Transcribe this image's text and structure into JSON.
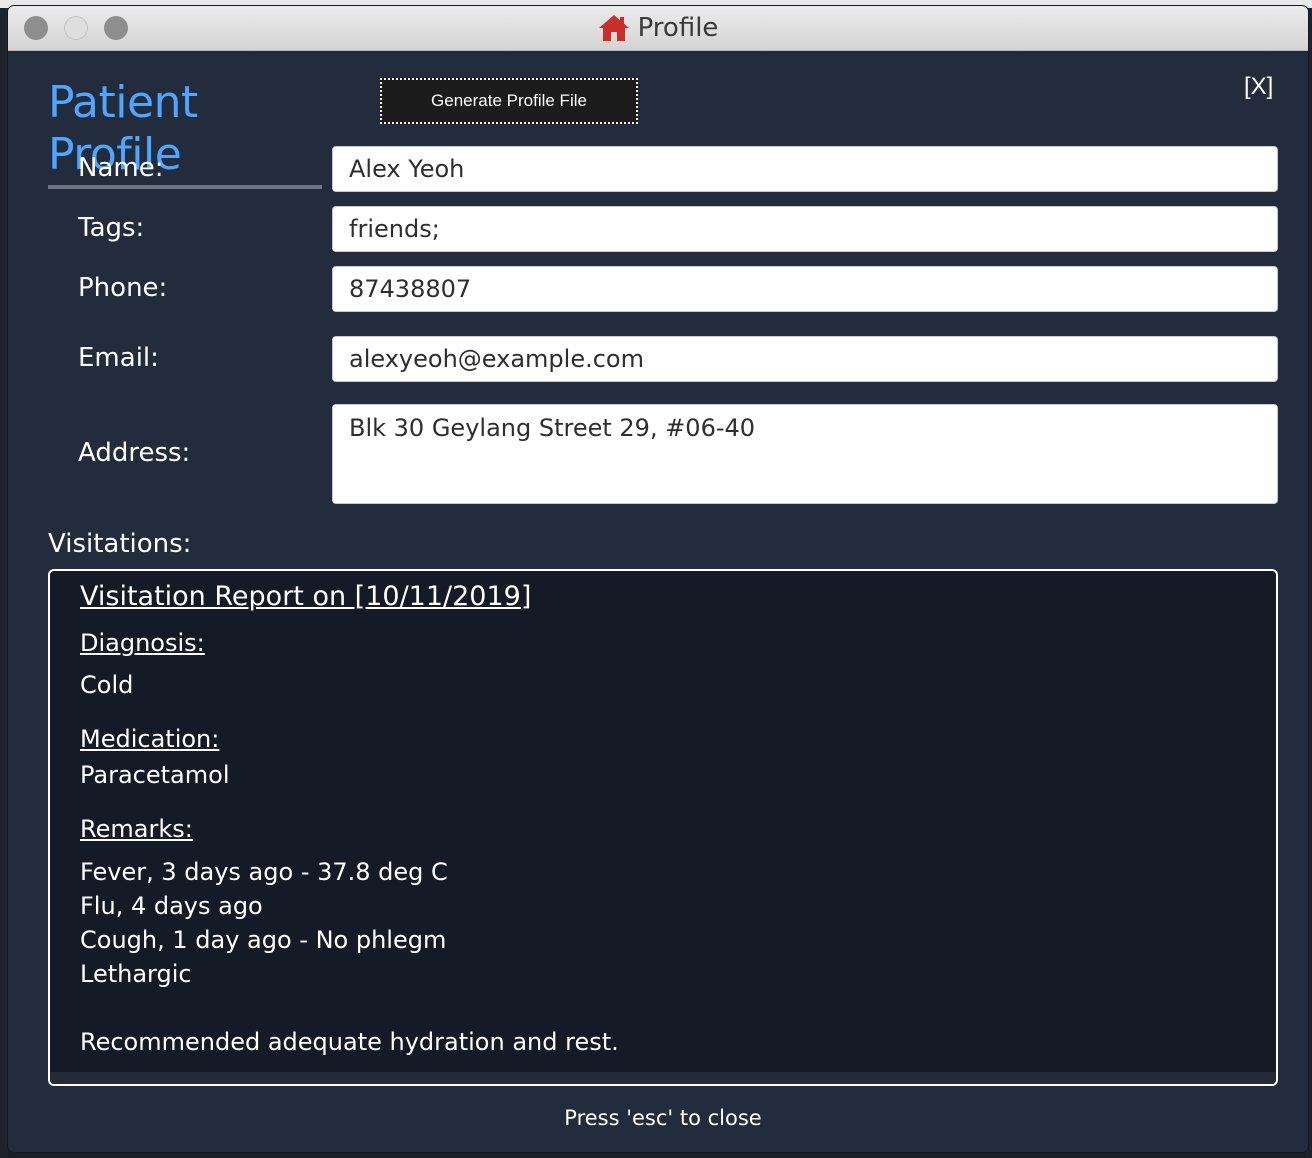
{
  "window": {
    "title": "Profile",
    "title_icon": "home-icon"
  },
  "header": {
    "page_title": "Patient Profile",
    "generate_button": "Generate Profile File",
    "close_label": "[X]"
  },
  "fields": {
    "name": {
      "label": "Name:",
      "value": "Alex Yeoh"
    },
    "tags": {
      "label": "Tags:",
      "value": "friends;"
    },
    "phone": {
      "label": "Phone:",
      "value": "87438807"
    },
    "email": {
      "label": "Email:",
      "value": "alexyeoh@example.com"
    },
    "address": {
      "label": "Address:",
      "value": "Blk 30 Geylang Street 29, #06-40"
    }
  },
  "visitations": {
    "heading": "Visitations:",
    "report": {
      "title": "Visitation Report on [10/11/2019]",
      "diagnosis_heading": "Diagnosis:",
      "diagnosis": "Cold",
      "medication_heading": "Medication:",
      "medication": "Paracetamol",
      "remarks_heading": "Remarks:",
      "remarks": [
        "Fever, 3 days ago - 37.8 deg C",
        "Flu, 4 days ago",
        "Cough, 1 day ago - No phlegm",
        "Lethargic",
        "",
        "Recommended adequate hydration and rest."
      ]
    }
  },
  "footer": {
    "hint": "Press 'esc' to close"
  },
  "colors": {
    "accent": "#4da6ff",
    "window_bg": "#222c3d",
    "panel_bg": "#141a26",
    "home_icon": "#c9302c"
  }
}
